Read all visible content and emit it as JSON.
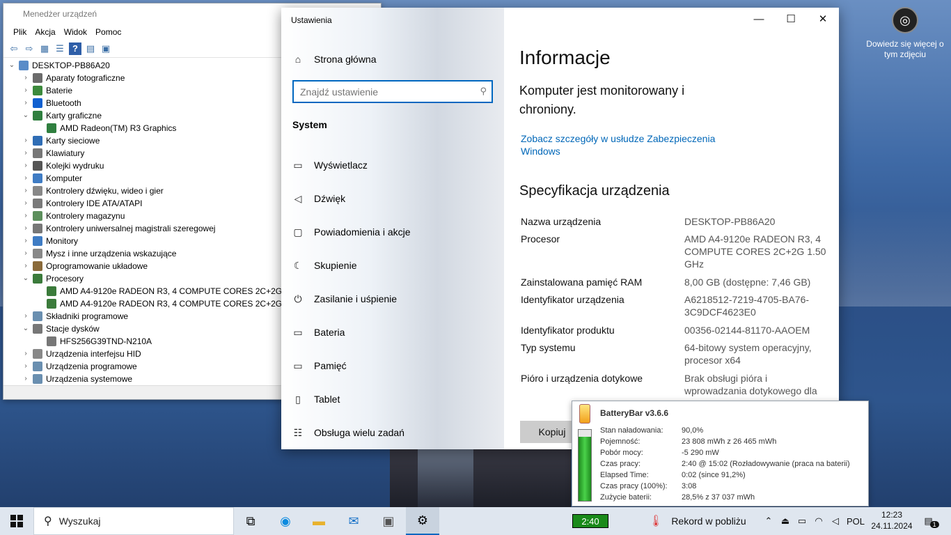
{
  "desktop": {
    "spotlight_text": "Dowiedz się więcej o tym zdjęciu"
  },
  "device_manager": {
    "title": "Menedżer urządzeń",
    "menu": [
      "Plik",
      "Akcja",
      "Widok",
      "Pomoc"
    ],
    "root": "DESKTOP-PB86A20",
    "nodes": [
      {
        "label": "Aparaty fotograficzne",
        "expanded": false,
        "icon": "camera-icon"
      },
      {
        "label": "Baterie",
        "expanded": false,
        "icon": "battery-icon"
      },
      {
        "label": "Bluetooth",
        "expanded": false,
        "icon": "bluetooth-icon"
      },
      {
        "label": "Karty graficzne",
        "expanded": true,
        "icon": "display-adapter-icon"
      },
      {
        "label": "AMD Radeon(TM) R3 Graphics",
        "child": true,
        "icon": "display-adapter-icon"
      },
      {
        "label": "Karty sieciowe",
        "expanded": false,
        "icon": "network-icon"
      },
      {
        "label": "Klawiatury",
        "expanded": false,
        "icon": "keyboard-icon"
      },
      {
        "label": "Kolejki wydruku",
        "expanded": false,
        "icon": "printer-icon"
      },
      {
        "label": "Komputer",
        "expanded": false,
        "icon": "computer-icon"
      },
      {
        "label": "Kontrolery dźwięku, wideo i gier",
        "expanded": false,
        "icon": "speaker-icon"
      },
      {
        "label": "Kontrolery IDE ATA/ATAPI",
        "expanded": false,
        "icon": "ide-icon"
      },
      {
        "label": "Kontrolery magazynu",
        "expanded": false,
        "icon": "storage-icon"
      },
      {
        "label": "Kontrolery uniwersalnej magistrali szeregowej",
        "expanded": false,
        "icon": "usb-icon"
      },
      {
        "label": "Monitory",
        "expanded": false,
        "icon": "monitor-icon"
      },
      {
        "label": "Mysz i inne urządzenia wskazujące",
        "expanded": false,
        "icon": "mouse-icon"
      },
      {
        "label": "Oprogramowanie układowe",
        "expanded": false,
        "icon": "firmware-icon"
      },
      {
        "label": "Procesory",
        "expanded": true,
        "icon": "processor-icon"
      },
      {
        "label": "AMD A4-9120e RADEON R3, 4 COMPUTE CORES 2C+2G",
        "child": true,
        "icon": "processor-icon"
      },
      {
        "label": "AMD A4-9120e RADEON R3, 4 COMPUTE CORES 2C+2G",
        "child": true,
        "icon": "processor-icon"
      },
      {
        "label": "Składniki programowe",
        "expanded": false,
        "icon": "software-component-icon"
      },
      {
        "label": "Stacje dysków",
        "expanded": true,
        "icon": "disk-drive-icon"
      },
      {
        "label": "HFS256G39TND-N210A",
        "child": true,
        "icon": "disk-drive-icon"
      },
      {
        "label": "Urządzenia interfejsu HID",
        "expanded": false,
        "icon": "hid-icon"
      },
      {
        "label": "Urządzenia programowe",
        "expanded": false,
        "icon": "software-device-icon"
      },
      {
        "label": "Urządzenia systemowe",
        "expanded": false,
        "icon": "system-device-icon"
      }
    ]
  },
  "settings": {
    "app_title": "Ustawienia",
    "home_label": "Strona główna",
    "search_placeholder": "Znajdź ustawienie",
    "section_label": "System",
    "nav": [
      {
        "label": "Wyświetlacz",
        "icon": "display-icon"
      },
      {
        "label": "Dźwięk",
        "icon": "sound-icon"
      },
      {
        "label": "Powiadomienia i akcje",
        "icon": "notifications-icon"
      },
      {
        "label": "Skupienie",
        "icon": "focus-icon"
      },
      {
        "label": "Zasilanie i uśpienie",
        "icon": "power-icon"
      },
      {
        "label": "Bateria",
        "icon": "battery-icon"
      },
      {
        "label": "Pamięć",
        "icon": "storage-icon"
      },
      {
        "label": "Tablet",
        "icon": "tablet-icon"
      },
      {
        "label": "Obsługa wielu zadań",
        "icon": "multitasking-icon"
      }
    ],
    "page_title": "Informacje",
    "protection_text": "Komputer jest monitorowany i chroniony.",
    "security_link": "Zobacz szczegóły w usłudze Zabezpieczenia Windows",
    "spec_heading": "Specyfikacja urządzenia",
    "specs": [
      {
        "label": "Nazwa urządzenia",
        "value": "DESKTOP-PB86A20"
      },
      {
        "label": "Procesor",
        "value": "AMD A4-9120e RADEON R3, 4 COMPUTE CORES 2C+2G 1.50 GHz"
      },
      {
        "label": "Zainstalowana pamięć RAM",
        "value": "8,00 GB (dostępne: 7,46 GB)"
      },
      {
        "label": "Identyfikator urządzenia",
        "value": "A6218512-7219-4705-BA76-3C9DCF4623E0"
      },
      {
        "label": "Identyfikator produktu",
        "value": "00356-02144-81170-AAOEM"
      },
      {
        "label": "Typ systemu",
        "value": "64-bitowy system operacyjny, procesor x64"
      },
      {
        "label": "Pióro i urządzenia dotykowe",
        "value": "Brak obsługi pióra i wprowadzania dotykowego dla"
      }
    ],
    "copy_button": "Kopiuj"
  },
  "battery_bar": {
    "title": "BatteryBar v3.6.6",
    "charge_fraction": 0.9,
    "rows": [
      {
        "label": "Stan naładowania:",
        "value": "90,0%"
      },
      {
        "label": "Pojemność:",
        "value": "23 808 mWh z 26 465 mWh"
      },
      {
        "label": "Pobór mocy:",
        "value": "-5 290 mW"
      },
      {
        "label": "Czas pracy:",
        "value": "2:40 @ 15:02 (Rozładowywanie (praca na baterii)"
      },
      {
        "label": "Elapsed Time:",
        "value": "0:02 (since 91,2%)"
      },
      {
        "label": "Czas pracy (100%):",
        "value": "3:08"
      },
      {
        "label": "Zużycie baterii:",
        "value": "28,5% z 37 037 mWh"
      }
    ]
  },
  "taskbar": {
    "search_text": "Wyszukaj",
    "battery_badge": "2:40",
    "weather_text": "Rekord w pobliżu",
    "language": "POL",
    "time": "12:23",
    "date": "24.11.2024",
    "notification_count": "1",
    "colors": {
      "accent": "#0067c0",
      "battery_green": "#1a8a1a"
    }
  }
}
